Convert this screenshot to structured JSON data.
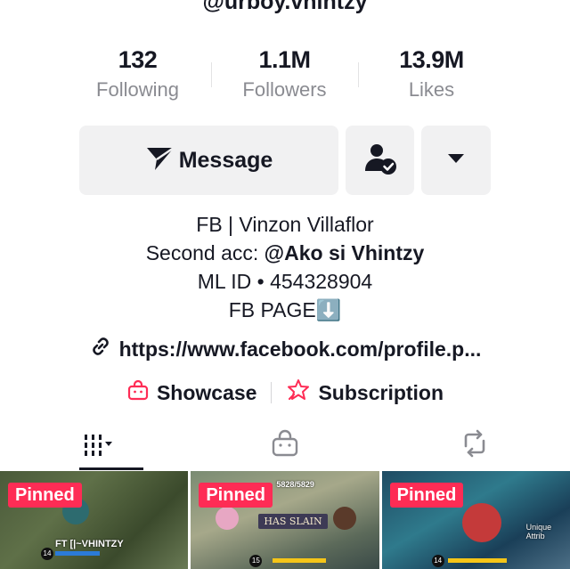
{
  "profile": {
    "username": "@urboy.vhintzy"
  },
  "stats": [
    {
      "value": "132",
      "label": "Following"
    },
    {
      "value": "1.1M",
      "label": "Followers"
    },
    {
      "value": "13.9M",
      "label": "Likes"
    }
  ],
  "actions": {
    "message_label": "Message",
    "message_icon": "send-icon",
    "follow_icon": "user-check-icon",
    "more_icon": "caret-down-icon"
  },
  "bio": {
    "line1": "FB | Vinzon Villaflor",
    "line2_prefix": "Second acc: ",
    "line2_mention": "@Ako si Vhintzy",
    "line3": "ML ID • 454328904",
    "line4": "FB PAGE⬇️"
  },
  "link": {
    "icon": "link-icon",
    "text": "https://www.facebook.com/profile.p..."
  },
  "shop": {
    "showcase_label": "Showcase",
    "showcase_icon": "shopping-bag-icon",
    "subscription_label": "Subscription",
    "subscription_icon": "star-badge-icon"
  },
  "tabs": [
    {
      "icon": "videos-grid-icon",
      "active": true
    },
    {
      "icon": "shopping-bag-icon",
      "active": false
    },
    {
      "icon": "repost-icon",
      "active": false
    }
  ],
  "videos": [
    {
      "pinned_label": "Pinned",
      "overlay": "FT [|~VHINTZY",
      "level": "14"
    },
    {
      "pinned_label": "Pinned",
      "overlay": "HAS SLAIN",
      "level": "15",
      "top_text": "5828/5829"
    },
    {
      "pinned_label": "Pinned",
      "overlay": "Unique Attrib",
      "level": "14"
    }
  ],
  "colors": {
    "accent": "#fe2c55",
    "text": "#161823",
    "muted": "#8a8b91",
    "button_bg": "#f1f1f2"
  }
}
